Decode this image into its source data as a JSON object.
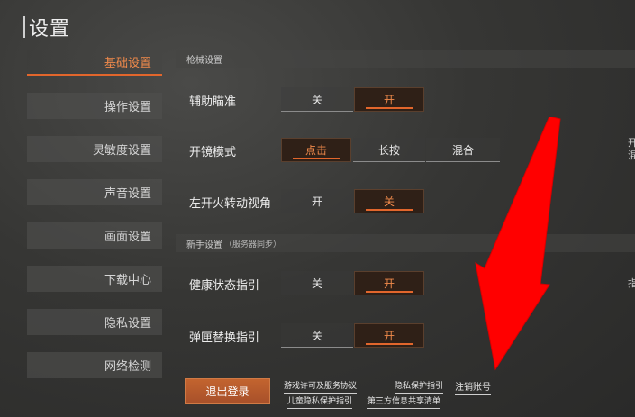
{
  "title": "设置",
  "sidebar": {
    "items": [
      {
        "label": "基础设置",
        "active": true
      },
      {
        "label": "操作设置",
        "active": false
      },
      {
        "label": "灵敏度设置",
        "active": false
      },
      {
        "label": "声音设置",
        "active": false
      },
      {
        "label": "画面设置",
        "active": false
      },
      {
        "label": "下载中心",
        "active": false
      },
      {
        "label": "隐私设置",
        "active": false
      },
      {
        "label": "网络检测",
        "active": false
      }
    ]
  },
  "sections": {
    "weapons": {
      "title": "枪械设置"
    },
    "novice": {
      "title": "新手设置",
      "subtitle": "（服务器同步）"
    }
  },
  "settings": {
    "aim_assist": {
      "label": "辅助瞄准",
      "options": [
        "关",
        "开"
      ],
      "selected": "开"
    },
    "scope_mode": {
      "label": "开镜模式",
      "options": [
        "点击",
        "长按",
        "混合"
      ],
      "selected": "点击"
    },
    "left_fire_view": {
      "label": "左开火转动视角",
      "options": [
        "开",
        "关"
      ],
      "selected": "关"
    },
    "health_guide": {
      "label": "健康状态指引",
      "options": [
        "关",
        "开"
      ],
      "selected": "开"
    },
    "clip_guide": {
      "label": "弹匣替换指引",
      "options": [
        "关",
        "开"
      ],
      "selected": "开"
    }
  },
  "footer": {
    "logout_label": "退出登录",
    "links": {
      "license": "游戏许可及服务协议",
      "privacy": "隐私保护指引",
      "deregister": "注销账号",
      "child_privacy": "儿童隐私保护指引",
      "third_party": "第三方信息共享清单"
    }
  },
  "edge_glyphs": [
    "开",
    "指",
    "混"
  ],
  "colors": {
    "accent": "#e2662c",
    "accent_text": "#f08a4b",
    "arrow": "#ff0000"
  }
}
